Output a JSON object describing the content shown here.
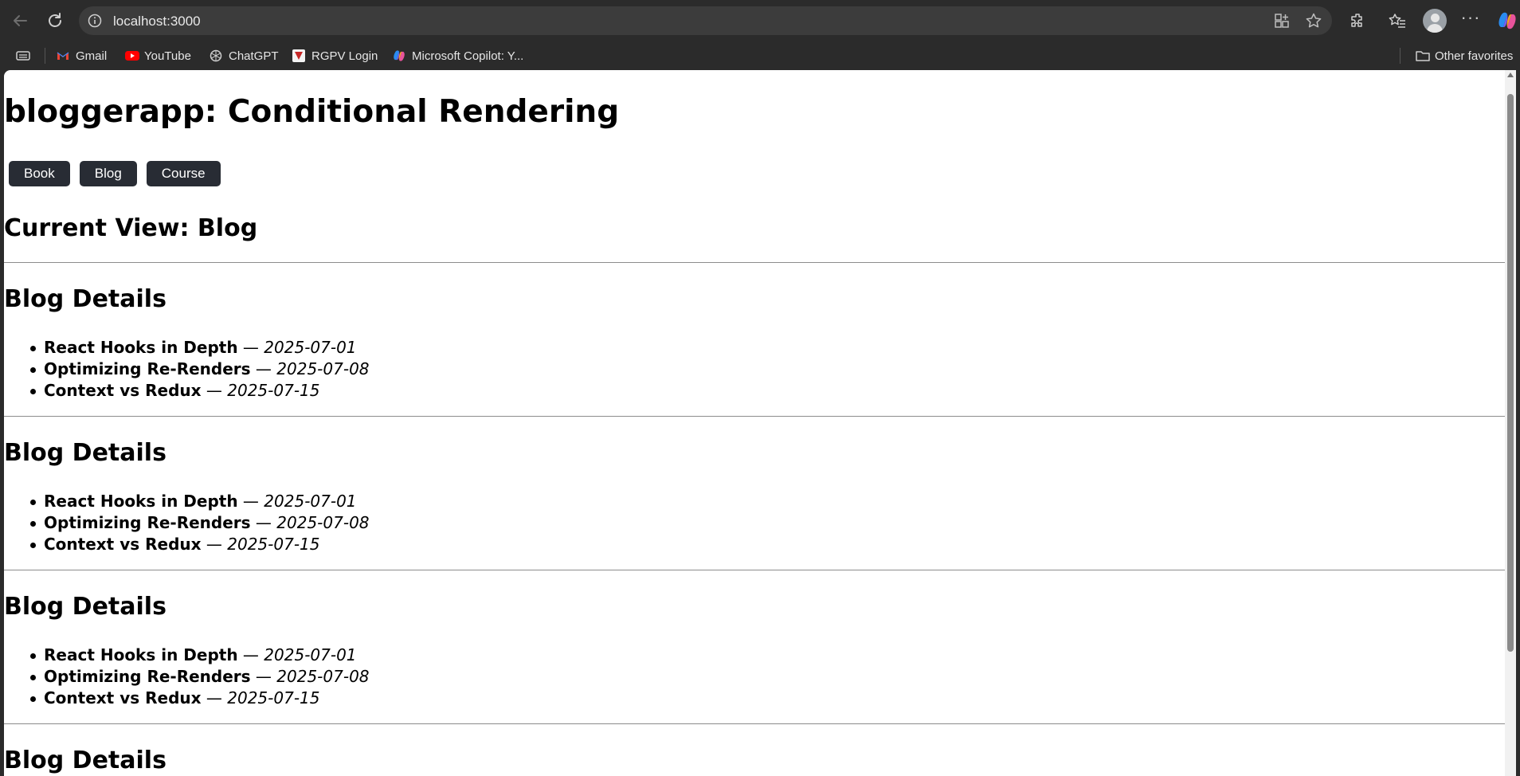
{
  "browser": {
    "url": "localhost:3000",
    "bookmarks": [
      {
        "label": "Gmail",
        "icon": "gmail-icon"
      },
      {
        "label": "YouTube",
        "icon": "youtube-icon"
      },
      {
        "label": "ChatGPT",
        "icon": "chatgpt-icon"
      },
      {
        "label": "RGPV Login",
        "icon": "rgpv-icon"
      },
      {
        "label": "Microsoft Copilot: Y...",
        "icon": "copilot-icon"
      }
    ],
    "other_favorites": "Other favorites"
  },
  "page": {
    "title": "bloggerapp: Conditional Rendering",
    "buttons": [
      "Book",
      "Blog",
      "Course"
    ],
    "current_view": "Current View: Blog",
    "sections": [
      {
        "heading": "Blog Details",
        "items": [
          {
            "title": "React Hooks in Depth",
            "date": "2025-07-01"
          },
          {
            "title": "Optimizing Re-Renders",
            "date": "2025-07-08"
          },
          {
            "title": "Context vs Redux",
            "date": "2025-07-15"
          }
        ]
      },
      {
        "heading": "Blog Details",
        "items": [
          {
            "title": "React Hooks in Depth",
            "date": "2025-07-01"
          },
          {
            "title": "Optimizing Re-Renders",
            "date": "2025-07-08"
          },
          {
            "title": "Context vs Redux",
            "date": "2025-07-15"
          }
        ]
      },
      {
        "heading": "Blog Details",
        "items": [
          {
            "title": "React Hooks in Depth",
            "date": "2025-07-01"
          },
          {
            "title": "Optimizing Re-Renders",
            "date": "2025-07-08"
          },
          {
            "title": "Context vs Redux",
            "date": "2025-07-15"
          }
        ]
      },
      {
        "heading": "Blog Details",
        "items": []
      }
    ],
    "separator": " — "
  },
  "colors": {
    "button_bg": "#282c34",
    "chrome_bg": "#2b2b2b",
    "omnibox_bg": "#3c3c3c"
  }
}
